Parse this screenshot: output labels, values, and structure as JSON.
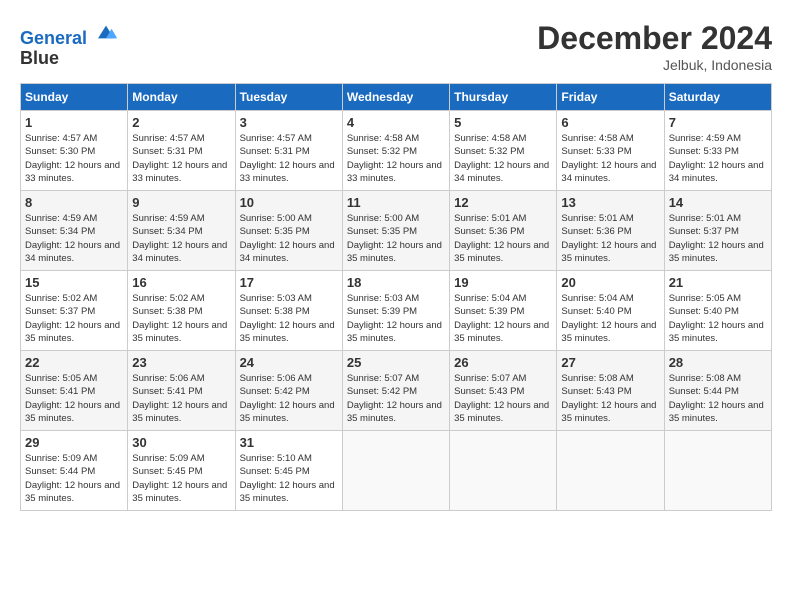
{
  "header": {
    "logo_line1": "General",
    "logo_line2": "Blue",
    "month_title": "December 2024",
    "location": "Jelbuk, Indonesia"
  },
  "weekdays": [
    "Sunday",
    "Monday",
    "Tuesday",
    "Wednesday",
    "Thursday",
    "Friday",
    "Saturday"
  ],
  "weeks": [
    [
      {
        "day": 1,
        "sunrise": "4:57 AM",
        "sunset": "5:30 PM",
        "daylight": "12 hours and 33 minutes."
      },
      {
        "day": 2,
        "sunrise": "4:57 AM",
        "sunset": "5:31 PM",
        "daylight": "12 hours and 33 minutes."
      },
      {
        "day": 3,
        "sunrise": "4:57 AM",
        "sunset": "5:31 PM",
        "daylight": "12 hours and 33 minutes."
      },
      {
        "day": 4,
        "sunrise": "4:58 AM",
        "sunset": "5:32 PM",
        "daylight": "12 hours and 33 minutes."
      },
      {
        "day": 5,
        "sunrise": "4:58 AM",
        "sunset": "5:32 PM",
        "daylight": "12 hours and 34 minutes."
      },
      {
        "day": 6,
        "sunrise": "4:58 AM",
        "sunset": "5:33 PM",
        "daylight": "12 hours and 34 minutes."
      },
      {
        "day": 7,
        "sunrise": "4:59 AM",
        "sunset": "5:33 PM",
        "daylight": "12 hours and 34 minutes."
      }
    ],
    [
      {
        "day": 8,
        "sunrise": "4:59 AM",
        "sunset": "5:34 PM",
        "daylight": "12 hours and 34 minutes."
      },
      {
        "day": 9,
        "sunrise": "4:59 AM",
        "sunset": "5:34 PM",
        "daylight": "12 hours and 34 minutes."
      },
      {
        "day": 10,
        "sunrise": "5:00 AM",
        "sunset": "5:35 PM",
        "daylight": "12 hours and 34 minutes."
      },
      {
        "day": 11,
        "sunrise": "5:00 AM",
        "sunset": "5:35 PM",
        "daylight": "12 hours and 35 minutes."
      },
      {
        "day": 12,
        "sunrise": "5:01 AM",
        "sunset": "5:36 PM",
        "daylight": "12 hours and 35 minutes."
      },
      {
        "day": 13,
        "sunrise": "5:01 AM",
        "sunset": "5:36 PM",
        "daylight": "12 hours and 35 minutes."
      },
      {
        "day": 14,
        "sunrise": "5:01 AM",
        "sunset": "5:37 PM",
        "daylight": "12 hours and 35 minutes."
      }
    ],
    [
      {
        "day": 15,
        "sunrise": "5:02 AM",
        "sunset": "5:37 PM",
        "daylight": "12 hours and 35 minutes."
      },
      {
        "day": 16,
        "sunrise": "5:02 AM",
        "sunset": "5:38 PM",
        "daylight": "12 hours and 35 minutes."
      },
      {
        "day": 17,
        "sunrise": "5:03 AM",
        "sunset": "5:38 PM",
        "daylight": "12 hours and 35 minutes."
      },
      {
        "day": 18,
        "sunrise": "5:03 AM",
        "sunset": "5:39 PM",
        "daylight": "12 hours and 35 minutes."
      },
      {
        "day": 19,
        "sunrise": "5:04 AM",
        "sunset": "5:39 PM",
        "daylight": "12 hours and 35 minutes."
      },
      {
        "day": 20,
        "sunrise": "5:04 AM",
        "sunset": "5:40 PM",
        "daylight": "12 hours and 35 minutes."
      },
      {
        "day": 21,
        "sunrise": "5:05 AM",
        "sunset": "5:40 PM",
        "daylight": "12 hours and 35 minutes."
      }
    ],
    [
      {
        "day": 22,
        "sunrise": "5:05 AM",
        "sunset": "5:41 PM",
        "daylight": "12 hours and 35 minutes."
      },
      {
        "day": 23,
        "sunrise": "5:06 AM",
        "sunset": "5:41 PM",
        "daylight": "12 hours and 35 minutes."
      },
      {
        "day": 24,
        "sunrise": "5:06 AM",
        "sunset": "5:42 PM",
        "daylight": "12 hours and 35 minutes."
      },
      {
        "day": 25,
        "sunrise": "5:07 AM",
        "sunset": "5:42 PM",
        "daylight": "12 hours and 35 minutes."
      },
      {
        "day": 26,
        "sunrise": "5:07 AM",
        "sunset": "5:43 PM",
        "daylight": "12 hours and 35 minutes."
      },
      {
        "day": 27,
        "sunrise": "5:08 AM",
        "sunset": "5:43 PM",
        "daylight": "12 hours and 35 minutes."
      },
      {
        "day": 28,
        "sunrise": "5:08 AM",
        "sunset": "5:44 PM",
        "daylight": "12 hours and 35 minutes."
      }
    ],
    [
      {
        "day": 29,
        "sunrise": "5:09 AM",
        "sunset": "5:44 PM",
        "daylight": "12 hours and 35 minutes."
      },
      {
        "day": 30,
        "sunrise": "5:09 AM",
        "sunset": "5:45 PM",
        "daylight": "12 hours and 35 minutes."
      },
      {
        "day": 31,
        "sunrise": "5:10 AM",
        "sunset": "5:45 PM",
        "daylight": "12 hours and 35 minutes."
      },
      null,
      null,
      null,
      null
    ]
  ]
}
